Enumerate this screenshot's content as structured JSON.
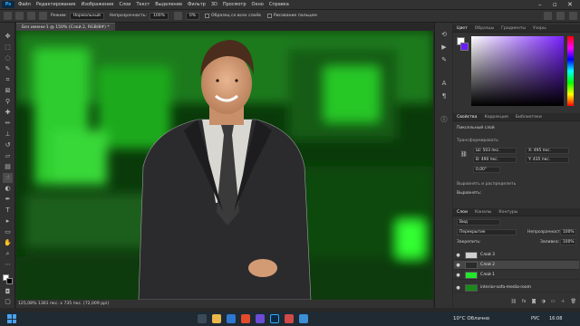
{
  "app": {
    "name": "Ps"
  },
  "menu": [
    "Файл",
    "Редактирование",
    "Изображение",
    "Слои",
    "Текст",
    "Выделение",
    "Фильтр",
    "3D",
    "Просмотр",
    "Окно",
    "Справка"
  ],
  "options": {
    "mode_label": "Режим:",
    "mode_value": "Нормальный",
    "opacity_label": "Непрозрачность:",
    "opacity_value": "100%",
    "flow_value": "0%",
    "sample_all": "Образец со всех слоёв",
    "draw_tablet": "Рисование пальцем"
  },
  "document": {
    "tab": "Без имени-1 @ 150% (Слой 2, RGB/8#) *"
  },
  "status": "125,08%   1361 пкс. x 735 пкс. (72,009 ppi)",
  "panel_color": {
    "tabs": [
      "Цвет",
      "Образцы",
      "Градиенты",
      "Узоры"
    ],
    "hue_color": "#7a22ff"
  },
  "panel_props": {
    "tabs": [
      "Свойства",
      "Коррекция",
      "Библиотеки"
    ],
    "layer_kind": "Пиксельный слой",
    "transform_title": "Трансформировать",
    "w": "Ш: 503 пкс.",
    "h": "В: 490 пкс.",
    "x": "X: 495 пкс.",
    "y": "Y: 435 пкс.",
    "angle": "0,00°",
    "align_title": "Выровнять и распределить",
    "align_sub": "Выровнять:"
  },
  "panel_layers": {
    "tabs": [
      "Слои",
      "Каналы",
      "Контуры"
    ],
    "search": "Вид",
    "blend": "Перекрытие",
    "opacity_label": "Непрозрачность:",
    "opacity": "100%",
    "lock_label": "Закрепить:",
    "fill_label": "Заливка:",
    "fill": "100%",
    "layers": [
      {
        "name": "Слой 3",
        "thumb": "#d0d0d0"
      },
      {
        "name": "Слой 2",
        "thumb": "#2a2a2a"
      },
      {
        "name": "Слой 1",
        "thumb": "#22e82c"
      },
      {
        "name": "interior-sofa-media-room",
        "thumb": "#1a8a1a"
      }
    ]
  },
  "taskbar": {
    "weather": "10°C  Облачно",
    "lang": "РУС",
    "time": "16:08"
  }
}
